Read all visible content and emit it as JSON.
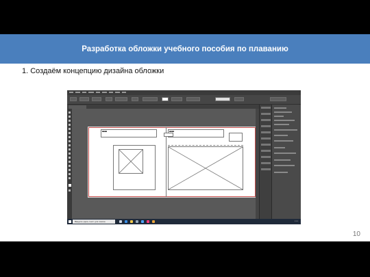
{
  "slide": {
    "title": "Разработка обложки учебного пособия по плаванию",
    "subtitle": "1. Создаём концепцию дизайна обложки",
    "page_number": "10"
  },
  "screenshot": {
    "app": "Adobe InDesign",
    "colors": {
      "title_bar": "#4a7fbd",
      "app_background": "#535353",
      "bleed_guide": "#c9504e"
    },
    "taskbar": {
      "search_placeholder": "Введите здесь текст для поиска"
    },
    "icons": [
      "windows-start-icon",
      "taskview-icon",
      "edge-icon",
      "explorer-icon",
      "store-icon",
      "mail-icon",
      "indesign-icon",
      "chrome-icon"
    ]
  }
}
